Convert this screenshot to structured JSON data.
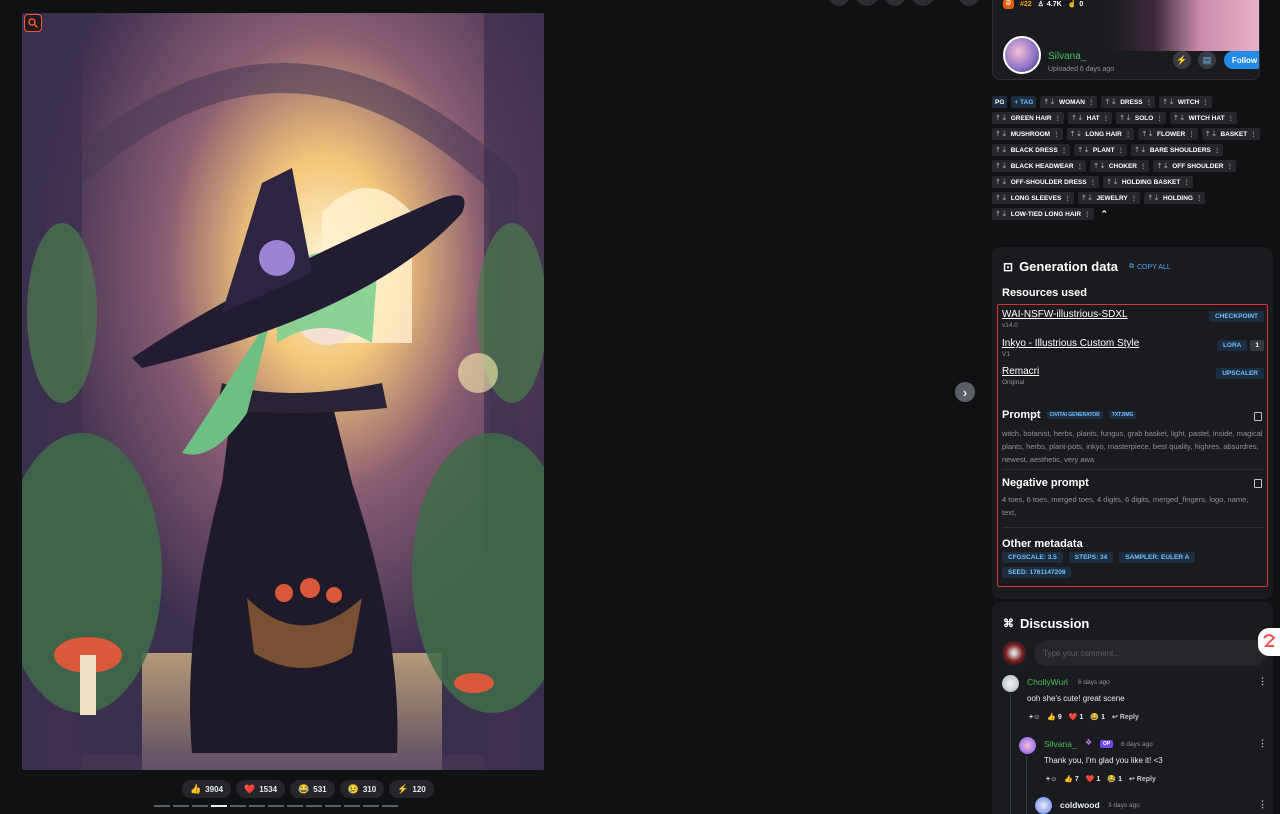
{
  "reactions": [
    {
      "emoji": "👍",
      "count": "3904"
    },
    {
      "emoji": "❤️",
      "count": "1534"
    },
    {
      "emoji": "😂",
      "count": "531"
    },
    {
      "emoji": "😢",
      "count": "310"
    },
    {
      "emoji": "⚡",
      "count": "120"
    }
  ],
  "creator": {
    "rank": "#22",
    "followers": "4.7K",
    "likes": "0",
    "name": "Silvana_",
    "uploaded": "Uploaded 6 days ago",
    "follow_label": "Follow"
  },
  "tags": [
    {
      "label": "PG",
      "kind": "pg"
    },
    {
      "label": "+ TAG",
      "kind": "add"
    },
    {
      "label": "WOMAN"
    },
    {
      "label": "DRESS"
    },
    {
      "label": "WITCH"
    },
    {
      "label": "GREEN HAIR"
    },
    {
      "label": "HAT"
    },
    {
      "label": "SOLO"
    },
    {
      "label": "WITCH HAT"
    },
    {
      "label": "MUSHROOM"
    },
    {
      "label": "LONG HAIR"
    },
    {
      "label": "FLOWER"
    },
    {
      "label": "BASKET"
    },
    {
      "label": "BLACK DRESS"
    },
    {
      "label": "PLANT"
    },
    {
      "label": "BARE SHOULDERS"
    },
    {
      "label": "BLACK HEADWEAR"
    },
    {
      "label": "CHOKER"
    },
    {
      "label": "OFF SHOULDER"
    },
    {
      "label": "OFF-SHOULDER DRESS"
    },
    {
      "label": "HOLDING BASKET"
    },
    {
      "label": "LONG SLEEVES"
    },
    {
      "label": "JEWELRY"
    },
    {
      "label": "HOLDING"
    },
    {
      "label": "LOW-TIED LONG HAIR"
    }
  ],
  "generation": {
    "title": "Generation data",
    "copy_all": "COPY ALL",
    "resources_title": "Resources used",
    "resources": [
      {
        "name": "WAI-NSFW-illustrious-SDXL",
        "version": "v14.0",
        "type": "CHECKPOINT",
        "weight": ""
      },
      {
        "name": "Inkyo - Illustrious Custom Style",
        "version": "V1",
        "type": "LORA",
        "weight": "1"
      },
      {
        "name": "Remacri",
        "version": "Original",
        "type": "UPSCALER",
        "weight": ""
      }
    ],
    "prompt_title": "Prompt",
    "prompt_badges": [
      "CIVITAI GENERATOR",
      "TXT2IMG"
    ],
    "prompt": "witch, botanist, herbs, plants, fungus, grab basket, light, pastel, inside, magical plants, herbs, plant-pots, inkyo, masterpiece, best quality, highres, absurdres, newest, aesthetic, very awa",
    "negative_title": "Negative prompt",
    "negative": "4 toes, 6 toes, merged toes, 4 digits, 6 digits, merged_fingers, logo, name, text,",
    "other_title": "Other metadata",
    "meta": [
      "CFGSCALE: 3.5",
      "STEPS: 34",
      "SAMPLER: EULER A",
      "SEED: 1761147208"
    ]
  },
  "discussion": {
    "title": "Discussion",
    "placeholder": "Type your comment...",
    "comments": [
      {
        "user": "ChollyWurl",
        "time": "6 days ago",
        "text": "ooh she's cute! great scene",
        "likes": "9",
        "hearts": "1",
        "laughs": "1",
        "reply": "Reply"
      },
      {
        "user": "Silvana_",
        "op": "OP",
        "time": "6 days ago",
        "text": "Thank you, I'm glad you like it! <3",
        "likes": "7",
        "hearts": "1",
        "laughs": "1",
        "reply": "Reply"
      },
      {
        "user": "coldwood",
        "time": "3 days ago"
      }
    ]
  }
}
